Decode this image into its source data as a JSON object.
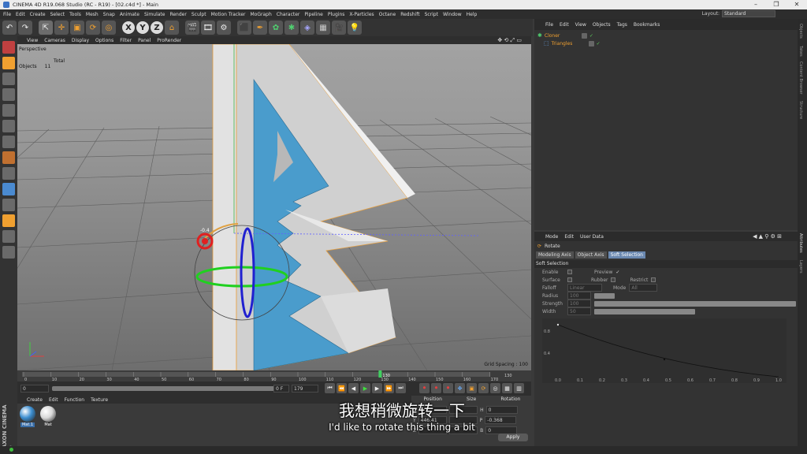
{
  "window": {
    "title": "CINEMA 4D R19.068 Studio (RC - R19) - [02.c4d *] - Main",
    "controls": [
      "–",
      "❐",
      "✕"
    ]
  },
  "menubar": {
    "items": [
      "File",
      "Edit",
      "Create",
      "Select",
      "Tools",
      "Mesh",
      "Snap",
      "Animate",
      "Simulate",
      "Render",
      "Sculpt",
      "Motion Tracker",
      "MoGraph",
      "Character",
      "Pipeline",
      "Plugins",
      "X-Particles",
      "Octane",
      "Redshift",
      "Script",
      "Window",
      "Help"
    ],
    "layout_label": "Layout:",
    "layout_value": "Standard"
  },
  "toolbar": {
    "axis_labels": [
      "X",
      "Y",
      "Z"
    ]
  },
  "viewport": {
    "menu": [
      "View",
      "Cameras",
      "Display",
      "Options",
      "Filter",
      "Panel",
      "ProRender"
    ],
    "name": "Perspective",
    "stats_header": "Total",
    "stats_label": "Objects",
    "stats_value": "11",
    "grid_spacing": "Grid Spacing : 100",
    "rotate_readout": "-0.4"
  },
  "timeline": {
    "ticks": [
      "0",
      "10",
      "20",
      "30",
      "40",
      "50",
      "60",
      "70",
      "80",
      "90",
      "100",
      "110",
      "120",
      "130",
      "140",
      "150",
      "160",
      "170"
    ],
    "current_frame": "130",
    "end_marker": "130",
    "start_field": "0",
    "range_field": "0 F",
    "end_field": "179",
    "end_field2": "179"
  },
  "material_manager": {
    "menu": [
      "Create",
      "Edit",
      "Function",
      "Texture"
    ],
    "materials": [
      {
        "name": "Mat.1",
        "color": "#3c8ed0"
      },
      {
        "name": "Mat",
        "color": "#d8d8d8"
      }
    ]
  },
  "coordinates": {
    "headers": [
      "Position",
      "Size",
      "Rotation"
    ],
    "rows": [
      {
        "axis": "X",
        "pos": "",
        "size": "",
        "rot_label": "H",
        "rot": "0"
      },
      {
        "axis": "Y",
        "pos": "446.41",
        "size": "",
        "rot_label": "P",
        "rot": "-0.368"
      },
      {
        "axis": "Z",
        "pos": "",
        "size": "",
        "rot_label": "B",
        "rot": "0"
      }
    ],
    "apply": "Apply"
  },
  "object_manager": {
    "menu": [
      "File",
      "Edit",
      "View",
      "Objects",
      "Tags",
      "Bookmarks"
    ],
    "objects": [
      {
        "name": "Cloner",
        "level": 0
      },
      {
        "name": "Triangles",
        "level": 1
      }
    ]
  },
  "attribute_manager": {
    "menu": [
      "Mode",
      "Edit",
      "User Data"
    ],
    "tool_name": "Rotate",
    "tabs": [
      "Modeling Axis",
      "Object Axis",
      "Soft Selection"
    ],
    "active_tab": "Soft Selection",
    "section": "Soft Selection",
    "enable_label": "Enable",
    "preview_label": "Preview",
    "surface_label": "Surface",
    "rubber_label": "Rubber",
    "restrict_label": "Restrict",
    "falloff_label": "Falloff",
    "falloff_value": "Linear",
    "mode_label": "Mode",
    "mode_value": "All",
    "radius_label": "Radius",
    "radius_value": "100",
    "strength_label": "Strength",
    "strength_value": "100",
    "width_label": "Width",
    "width_value": "50",
    "graph_y": [
      "0.8",
      "0.4"
    ],
    "graph_x": [
      "0.0",
      "0.1",
      "0.2",
      "0.3",
      "0.4",
      "0.5",
      "0.6",
      "0.7",
      "0.8",
      "0.9",
      "1.0"
    ]
  },
  "right_strip": [
    "Objects",
    "Takes",
    "Content Browser",
    "Structure"
  ],
  "right_strip_lower": [
    "Attributes",
    "Layers"
  ],
  "branding": "MAXON CINEMA 4D",
  "subtitles": {
    "zh": "我想稍微旋转一下",
    "en": "I'd like to rotate this thing a bit"
  }
}
